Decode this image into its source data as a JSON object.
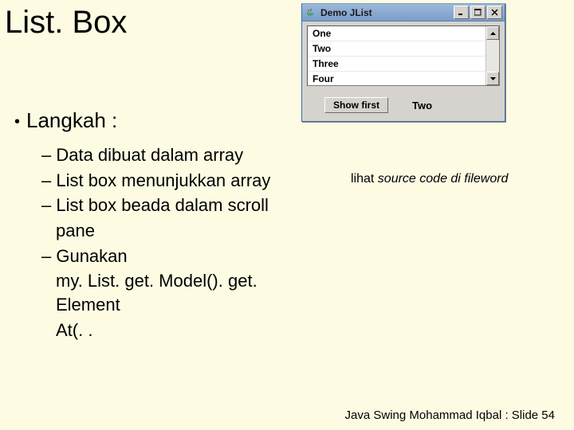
{
  "title": "List. Box",
  "bullet1": "Langkah :",
  "sub": {
    "a": "– Data dibuat dalam array",
    "b": "– List box menunjukkan array",
    "c": "– List box beada dalam scroll",
    "c2": "pane",
    "d": "– Gunakan",
    "d2": "my. List. get. Model(). get. Element",
    "d3": "At(. ."
  },
  "note_prefix": "lihat ",
  "note_em": "source code di fileword",
  "footer": "Java Swing Mohammad Iqbal : Slide 54",
  "win": {
    "title": "Demo JList",
    "items": [
      "One",
      "Two",
      "Three",
      "Four"
    ],
    "button": "Show first",
    "selected": "Two"
  }
}
